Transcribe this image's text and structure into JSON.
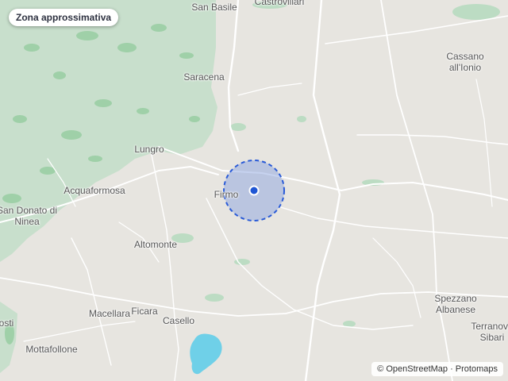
{
  "badge": {
    "label": "Zona approssimativa"
  },
  "places": [
    {
      "id": "san-basile",
      "name": "San Basile"
    },
    {
      "id": "castrovillari",
      "name": "Castrovillari"
    },
    {
      "id": "cassano",
      "name": "Cassano all'Ionio"
    },
    {
      "id": "saracena",
      "name": "Saracena"
    },
    {
      "id": "lungro",
      "name": "Lungro"
    },
    {
      "id": "acquaformosa",
      "name": "Acquaformosa"
    },
    {
      "id": "firmo",
      "name": "Firmo"
    },
    {
      "id": "san-donato",
      "name": "San Donato di Ninea"
    },
    {
      "id": "altomonte",
      "name": "Altomonte"
    },
    {
      "id": "spezzano",
      "name": "Spezzano Albanese"
    },
    {
      "id": "macellara",
      "name": "Macellara"
    },
    {
      "id": "ficara",
      "name": "Ficara"
    },
    {
      "id": "casello",
      "name": "Casello"
    },
    {
      "id": "terranova",
      "name": "Terranova Sibari"
    },
    {
      "id": "costi",
      "name": "osti"
    },
    {
      "id": "mottafollone",
      "name": "Mottafollone"
    }
  ],
  "attribution": {
    "text": "© OpenStreetMap · Protomaps"
  },
  "colors": {
    "land": "#e7e5e0",
    "forest": "#c8dfcc",
    "road": "#ffffff",
    "water": "#6fd0e8",
    "zone_fill": "#8ea6df",
    "zone_stroke": "#2a5bd7",
    "marker": "#1f56d4"
  }
}
